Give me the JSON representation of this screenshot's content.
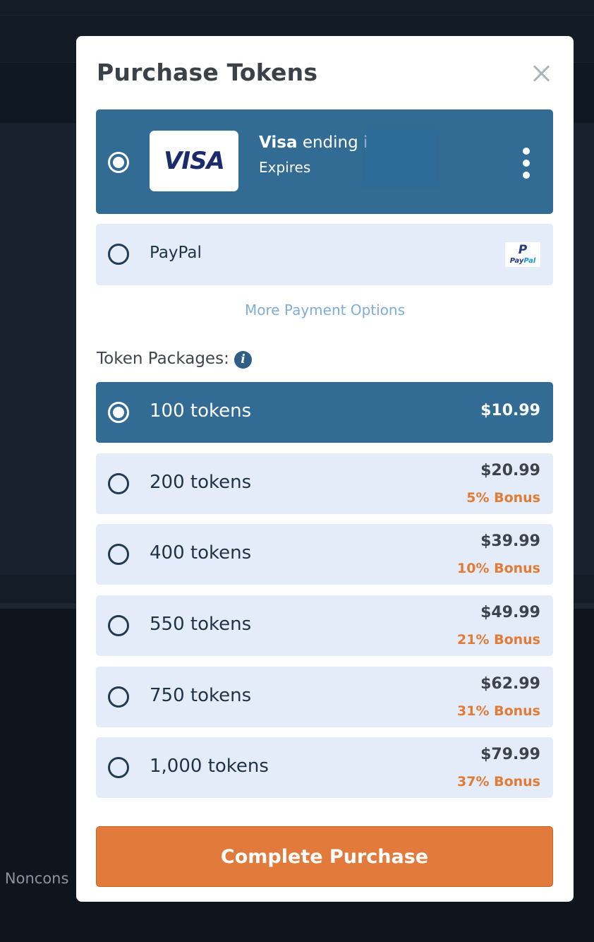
{
  "background": {
    "partial_text": "t Noncons"
  },
  "modal": {
    "title": "Purchase Tokens",
    "close_icon": "close-icon"
  },
  "payment_methods": {
    "card": {
      "brand_logo": "VISA",
      "brand": "Visa",
      "ending_text": "ending i",
      "expires_text": "Expires",
      "selected": true
    },
    "paypal": {
      "label": "PayPal",
      "logo_mark": "P",
      "logo_text_a": "Pay",
      "logo_text_b": "Pal",
      "selected": false
    },
    "more_options": "More Payment Options"
  },
  "packages": {
    "label": "Token Packages:",
    "info_icon": "i",
    "items": [
      {
        "label": "100 tokens",
        "price": "$10.99",
        "bonus": "",
        "selected": true
      },
      {
        "label": "200 tokens",
        "price": "$20.99",
        "bonus": "5% Bonus",
        "selected": false
      },
      {
        "label": "400 tokens",
        "price": "$39.99",
        "bonus": "10% Bonus",
        "selected": false
      },
      {
        "label": "550 tokens",
        "price": "$49.99",
        "bonus": "21% Bonus",
        "selected": false
      },
      {
        "label": "750 tokens",
        "price": "$62.99",
        "bonus": "31% Bonus",
        "selected": false
      },
      {
        "label": "1,000 tokens",
        "price": "$79.99",
        "bonus": "37% Bonus",
        "selected": false
      }
    ]
  },
  "actions": {
    "complete_label": "Complete Purchase"
  },
  "colors": {
    "selected_bg": "#326b93",
    "option_bg": "#e3ecf8",
    "accent_orange": "#e27a3b",
    "bonus_text": "#e27b35"
  }
}
